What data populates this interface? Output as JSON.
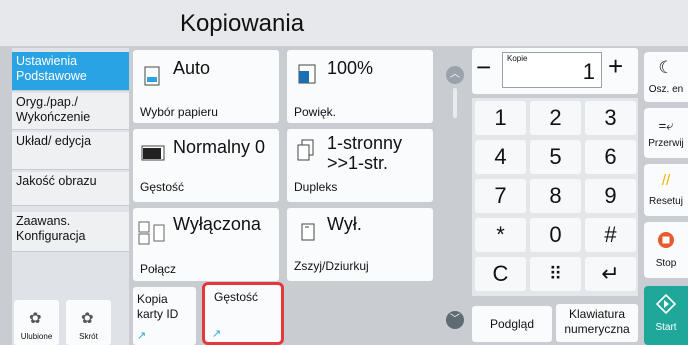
{
  "header": {
    "title": "Kopiowania"
  },
  "sidebar": {
    "items": [
      {
        "label": "Ustawienia Podstawowe"
      },
      {
        "label": "Oryg./pap./ Wykończenie"
      },
      {
        "label": "Układ/ edycja"
      },
      {
        "label": "Jakość obrazu"
      },
      {
        "label": "Zaawans. Konfiguracja"
      }
    ],
    "bottom": [
      {
        "label": "Ulubione",
        "icon": "gear-icon"
      },
      {
        "label": "Skrót",
        "icon": "gear-icon"
      }
    ]
  },
  "tiles": {
    "paper": {
      "value": "Auto",
      "label": "Wybór papieru"
    },
    "zoom": {
      "value": "100%",
      "label": "Powięk."
    },
    "density": {
      "value": "Normalny 0",
      "label": "Gęstość"
    },
    "duplex": {
      "value": "1-stronny >>1-str.",
      "label": "Dupleks"
    },
    "combine": {
      "value": "Wyłączona",
      "label": "Połącz"
    },
    "staple": {
      "value": "Wył.",
      "label": "Zszyj/Dziurkuj"
    },
    "idcard": {
      "label": "Kopia karty ID"
    },
    "density_shortcut": {
      "label": "Gęstość"
    }
  },
  "copies": {
    "label": "Kopie",
    "value": "1",
    "minus": "−",
    "plus": "+"
  },
  "keypad": {
    "keys": [
      "1",
      "2",
      "3",
      "4",
      "5",
      "6",
      "7",
      "8",
      "9",
      "*",
      "0",
      "#"
    ],
    "clear": "C",
    "enter": "↵"
  },
  "bottom": {
    "preview": "Podgląd",
    "keyboard": "Klawiatura numeryczna"
  },
  "right": {
    "energy": "Osz. en",
    "interrupt": "Przerwij",
    "reset": "Resetuj",
    "stop": "Stop",
    "start": "Start"
  },
  "colors": {
    "accent": "#2aa3e4",
    "highlight": "#e4393c",
    "reset": "#f0b400",
    "stop": "#e85a2a",
    "start": "#1fa79a"
  }
}
